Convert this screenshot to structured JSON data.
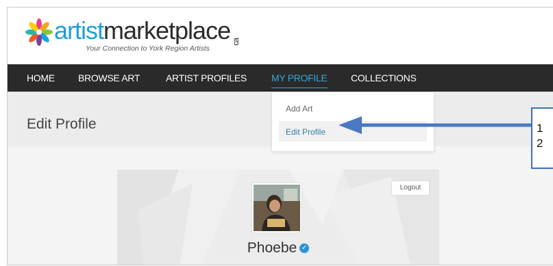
{
  "logo": {
    "word_artist": "artist",
    "word_marketplace": "marketplace",
    "word_ca": "ca",
    "tagline": "Your Connection to York Region Artists",
    "icon": "star-logo-icon"
  },
  "nav": {
    "items": [
      {
        "label": "HOME"
      },
      {
        "label": "BROWSE ART"
      },
      {
        "label": "ARTIST PROFILES"
      },
      {
        "label": "MY PROFILE",
        "active": true
      },
      {
        "label": "COLLECTIONS"
      }
    ]
  },
  "page": {
    "title": "Edit Profile"
  },
  "dropdown": {
    "items": [
      {
        "label": "Add Art"
      },
      {
        "label": "Edit Profile",
        "highlighted": true
      }
    ]
  },
  "profile": {
    "logout_label": "Logout",
    "name": "Phoebe",
    "verified_icon": "verified-check-icon"
  },
  "callout": {
    "line1": "1",
    "line2": "2",
    "arrow_icon": "arrow-left-icon"
  },
  "colors": {
    "accent": "#3aa7d8",
    "nav_bg": "#2a2a2a",
    "callout_border": "#3f6fb5",
    "arrow": "#4a78c2"
  }
}
